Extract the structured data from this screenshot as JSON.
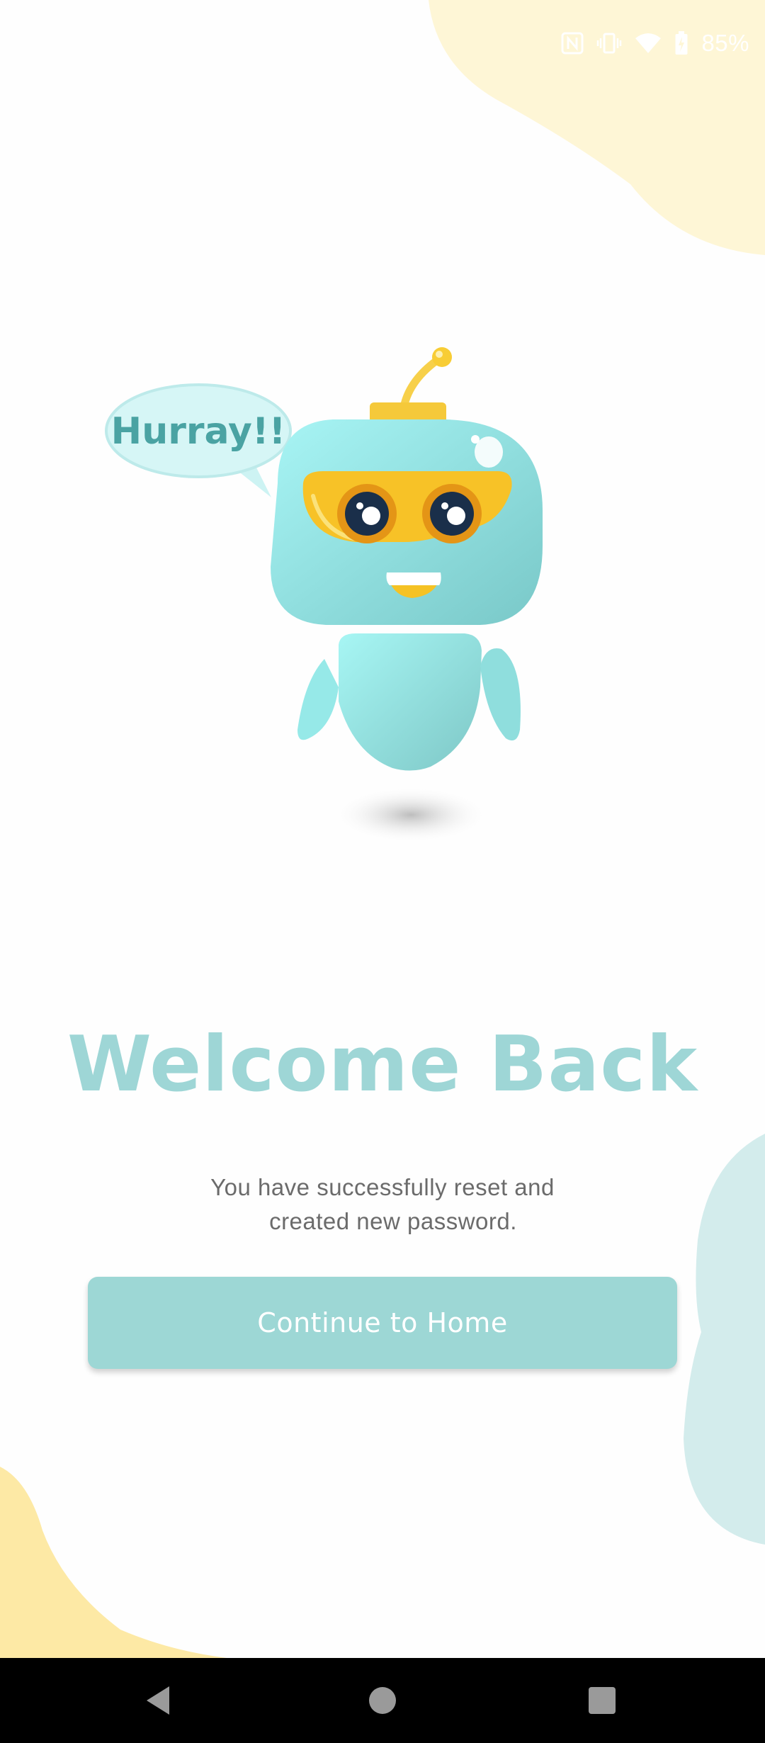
{
  "status_bar": {
    "battery_percent": "85%",
    "icons": [
      "nfc-icon",
      "vibrate-icon",
      "wifi-icon",
      "battery-icon"
    ]
  },
  "illustration": {
    "speech_bubble_text": "Hurray!!"
  },
  "welcome": {
    "title": "Welcome Back",
    "subtitle_line1": "You have successfully reset and",
    "subtitle_line2": "created new password."
  },
  "continue_button": {
    "label": "Continue to Home"
  },
  "nav_bar": {
    "icons": [
      "back-icon",
      "home-icon",
      "recents-icon"
    ]
  },
  "colors": {
    "accent_teal": "#9dd7d5",
    "title_teal": "#9ed6d6",
    "blob_yellow": "#fef7d8",
    "blob_yellow_bottom": "#fdeaa6",
    "blob_teal": "#d3ecec",
    "robot_body": "#8fe3e3",
    "robot_visor": "#f7c22a"
  }
}
